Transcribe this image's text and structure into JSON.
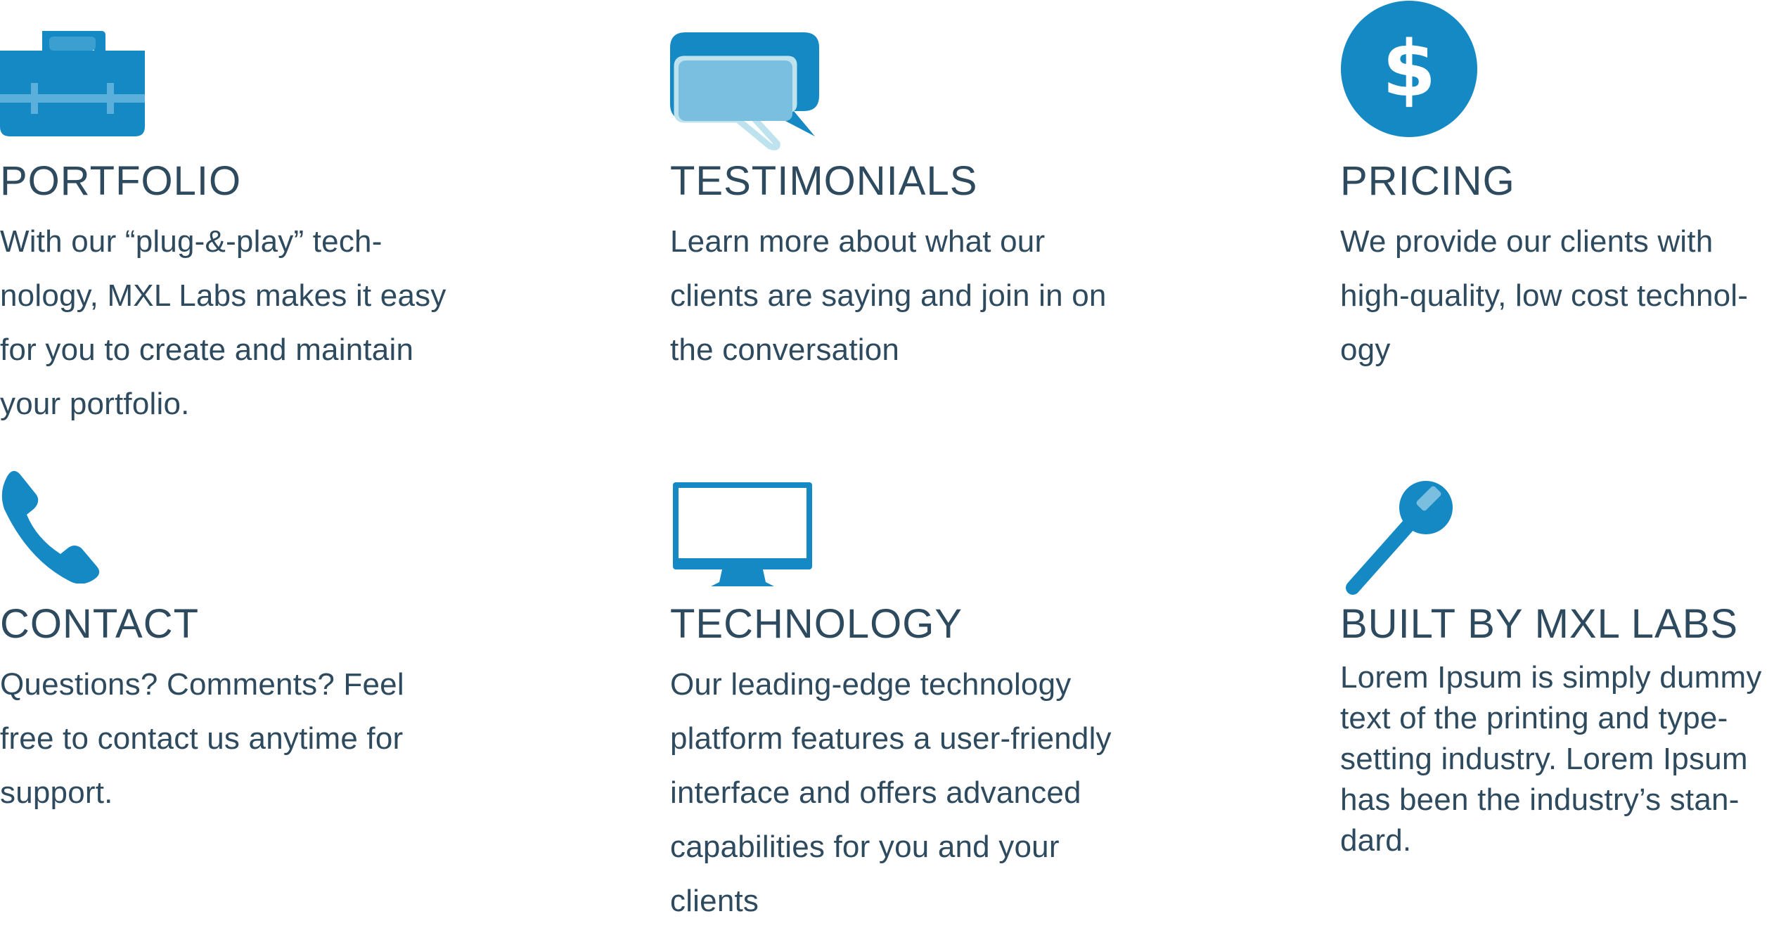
{
  "colors": {
    "primary": "#1589c4",
    "light": "#7bbfe0",
    "pale": "#bfe3ee",
    "text": "#2e4a5e",
    "background": "#ffffff"
  },
  "features": [
    {
      "icon": "briefcase-icon",
      "title": "PORTFOLIO",
      "lines": [
        "With our “plug-&-play” tech-",
        "nology, MXL Labs makes it easy",
        "for you to create and maintain",
        "your portfolio."
      ]
    },
    {
      "icon": "speech-bubbles-icon",
      "title": "TESTIMONIALS",
      "lines": [
        "Learn more about what our",
        "clients are saying and join in on",
        "the conversation"
      ]
    },
    {
      "icon": "dollar-coin-icon",
      "title": "PRICING",
      "lines": [
        "We provide our clients with",
        "high-quality, low cost technol-",
        "ogy"
      ]
    },
    {
      "icon": "phone-handset-icon",
      "title": "CONTACT",
      "lines": [
        "Questions? Comments? Feel",
        "free to contact us anytime for",
        "support."
      ]
    },
    {
      "icon": "desktop-monitor-icon",
      "title": "TECHNOLOGY",
      "lines": [
        "Our leading-edge technology",
        "platform features a user-friendly",
        "interface and offers advanced",
        "capabilities for you and your",
        "clients"
      ]
    },
    {
      "icon": "wrench-tool-icon",
      "title": "BUILT BY MXL LABS",
      "lines": [
        "Lorem Ipsum is simply dummy",
        "text of the printing and type-",
        "setting industry. Lorem Ipsum",
        "has been the industry’s stan-",
        "dard."
      ]
    }
  ]
}
